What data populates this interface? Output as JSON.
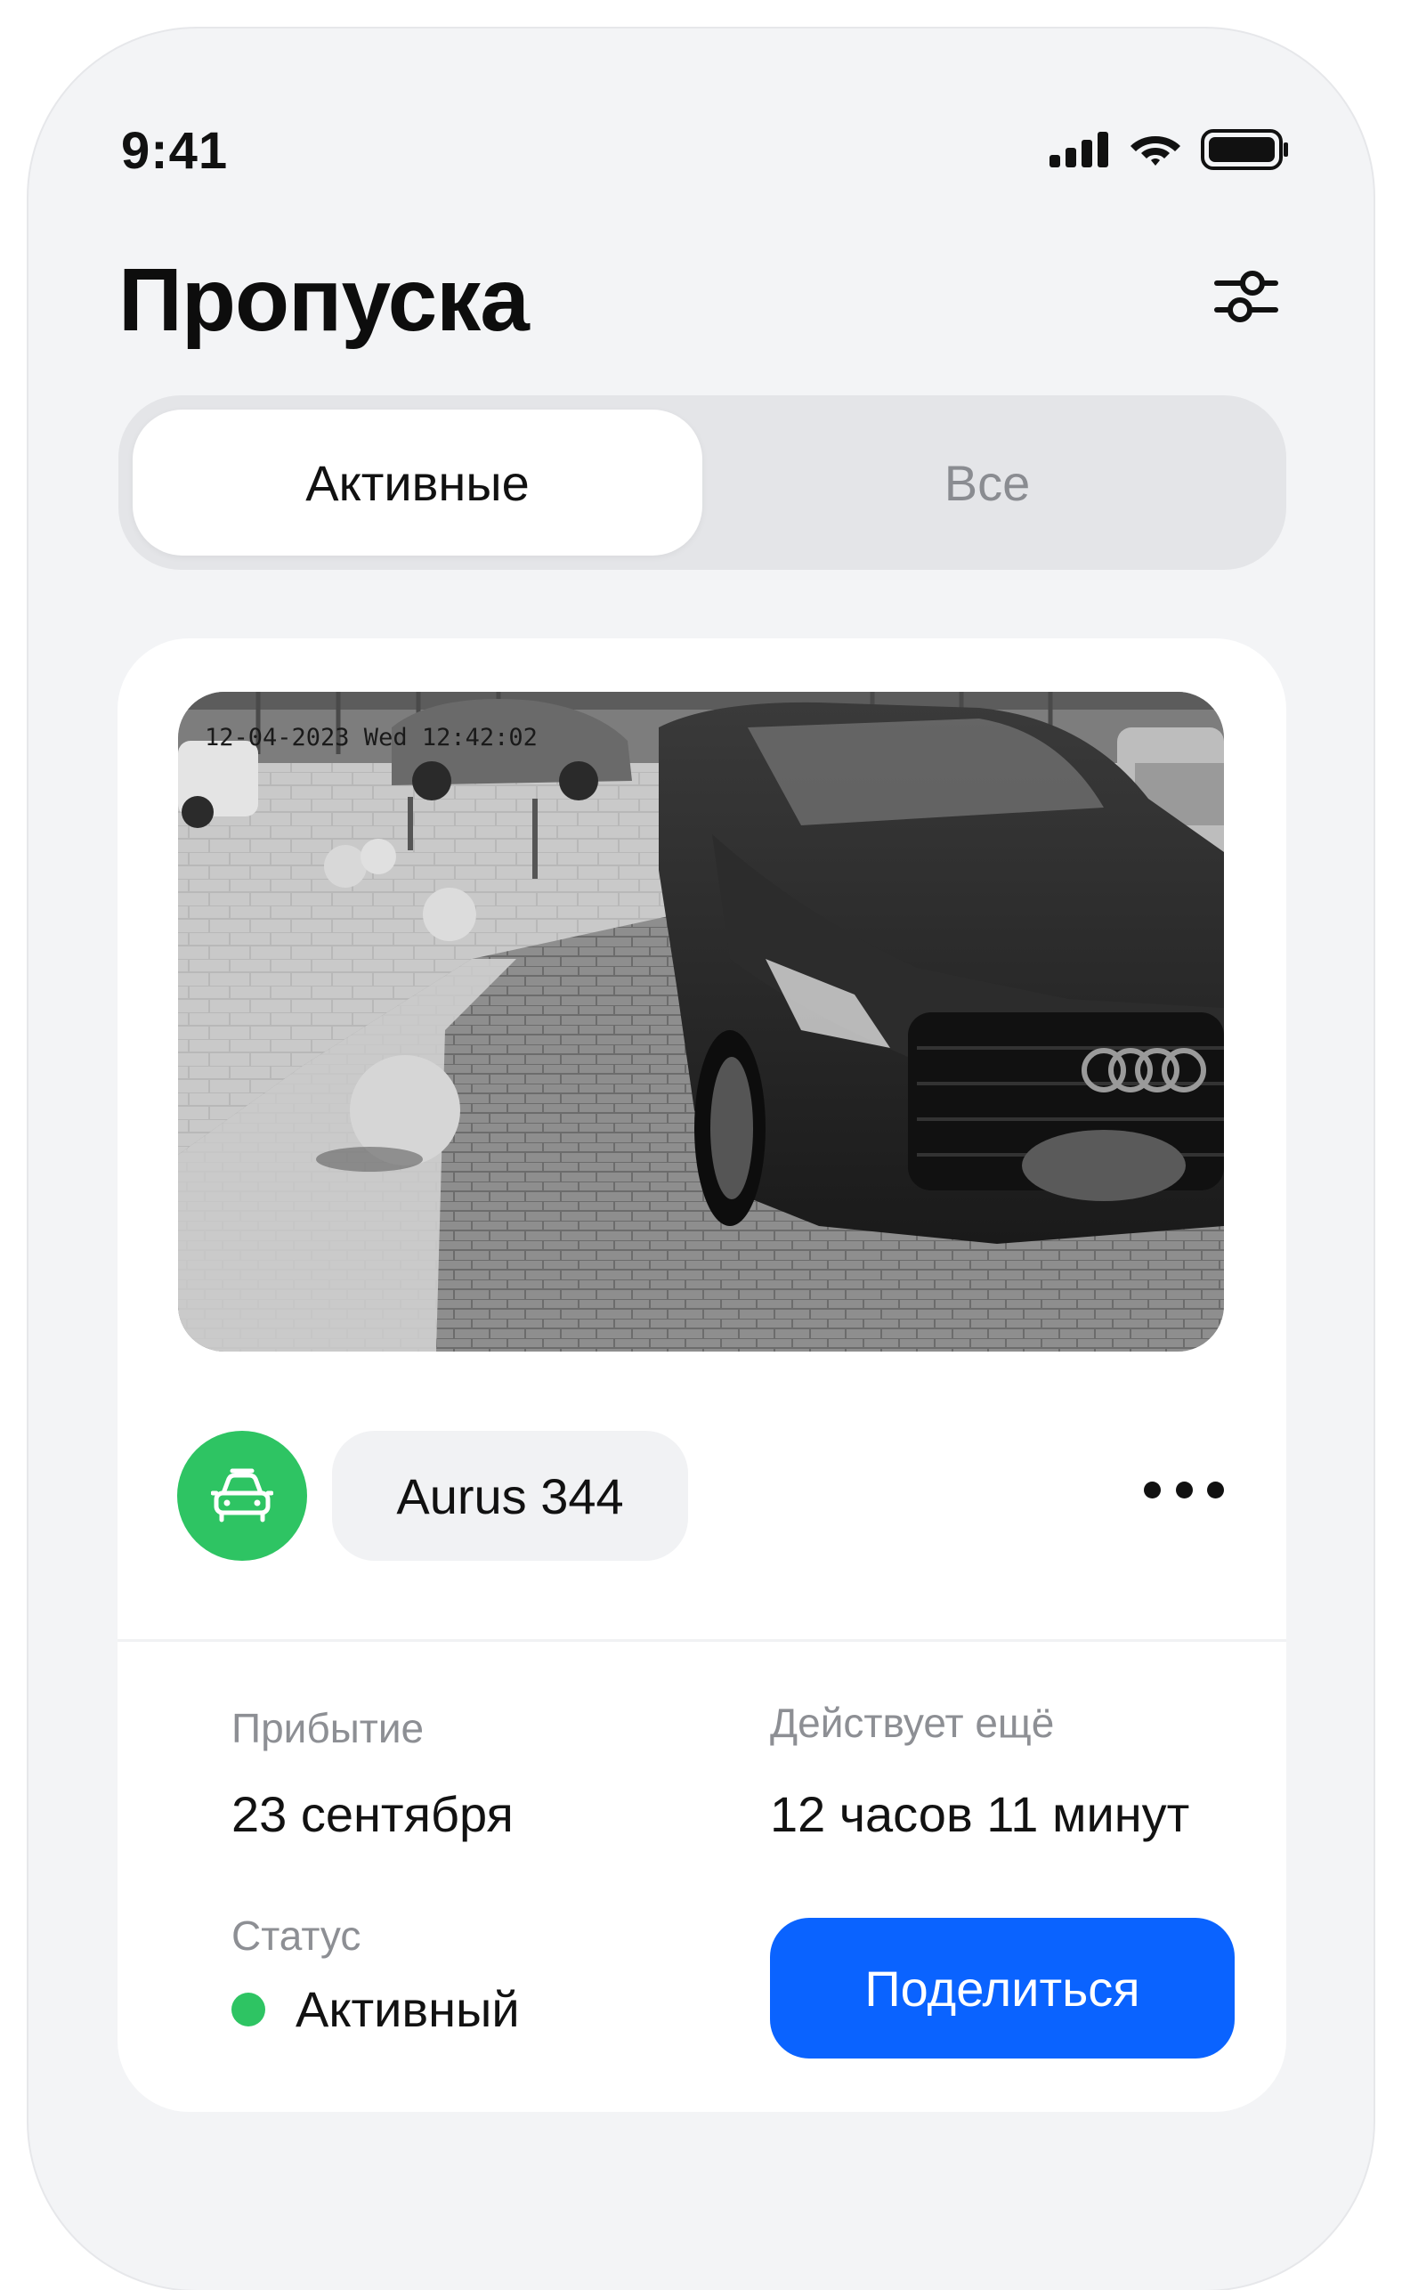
{
  "status_bar": {
    "time": "9:41",
    "icons": [
      "cellular-signal-icon",
      "wifi-icon",
      "battery-icon"
    ]
  },
  "header": {
    "title": "Пропуска",
    "filter_icon": "sliders-icon"
  },
  "tabs": [
    {
      "label": "Активные",
      "active": true
    },
    {
      "label": "Все",
      "active": false
    }
  ],
  "pass_card": {
    "camera_timestamp": "12-04-2023 Wed 12:42:02",
    "vehicle_icon": "car-icon",
    "plate": "Aurus 344",
    "more_icon": "more-horizontal-icon",
    "arrival_label": "Прибытие",
    "arrival_value": "23 сентября",
    "valid_label": "Действует ещё",
    "valid_value": "12 часов 11 минут",
    "status_label": "Статус",
    "status_value": "Активный",
    "share_label": "Поделиться"
  },
  "colors": {
    "accent_blue": "#0a63ff",
    "status_green": "#2ec463",
    "background": "#f3f4f6",
    "card": "#ffffff"
  }
}
